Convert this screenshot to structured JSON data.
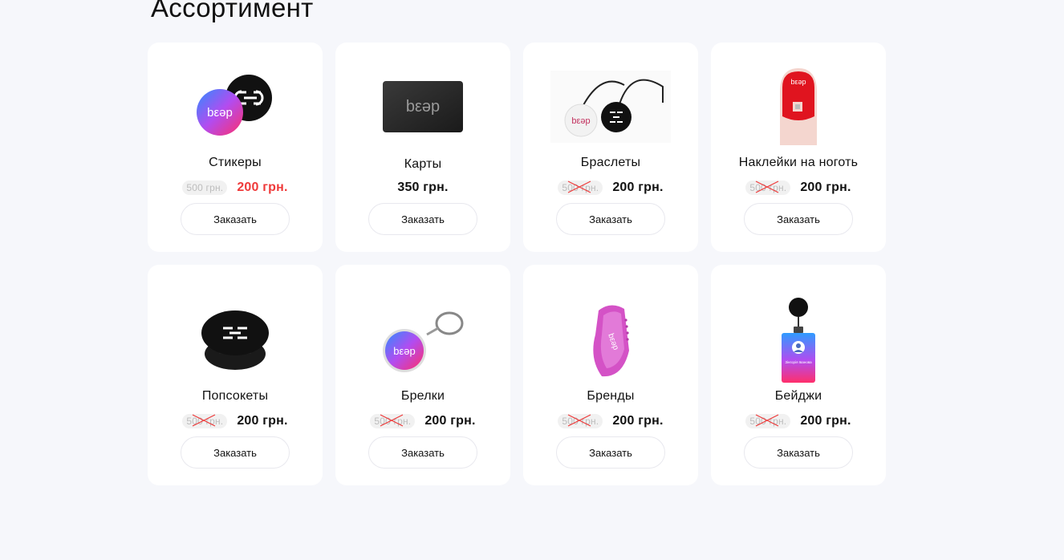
{
  "section": {
    "title": "Ассортимент"
  },
  "products": [
    {
      "name": "Стикеры",
      "old_price": "500 грн.",
      "price": "200 грн.",
      "order": "Заказать"
    },
    {
      "name": "Карты",
      "old_price": "",
      "price": "350 грн.",
      "order": "Заказать"
    },
    {
      "name": "Браслеты",
      "old_price": "500 грн.",
      "price": "200 грн.",
      "order": "Заказать"
    },
    {
      "name": "Наклейки на ноготь",
      "old_price": "500 грн.",
      "price": "200 грн.",
      "order": "Заказать"
    },
    {
      "name": "Попсокеты",
      "old_price": "500 грн.",
      "price": "200 грн.",
      "order": "Заказать"
    },
    {
      "name": "Брелки",
      "old_price": "500 грн.",
      "price": "200 грн.",
      "order": "Заказать"
    },
    {
      "name": "Бренды",
      "old_price": "500 грн.",
      "price": "200 грн.",
      "order": "Заказать"
    },
    {
      "name": "Бейджи",
      "old_price": "500 грн.",
      "price": "200 грн.",
      "order": "Заказать"
    }
  ],
  "brand": {
    "logo_text": "bεəp",
    "badge_name": "Зінгорія Іванова"
  },
  "colors": {
    "sale": "#ef3a3a",
    "background": "#f6f7fb",
    "card": "#ffffff"
  }
}
